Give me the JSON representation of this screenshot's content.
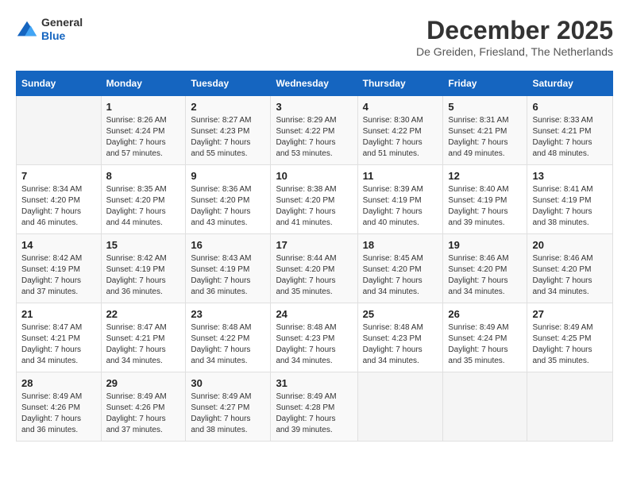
{
  "logo": {
    "general": "General",
    "blue": "Blue"
  },
  "title": "December 2025",
  "location": "De Greiden, Friesland, The Netherlands",
  "headers": [
    "Sunday",
    "Monday",
    "Tuesday",
    "Wednesday",
    "Thursday",
    "Friday",
    "Saturday"
  ],
  "weeks": [
    [
      {
        "day": "",
        "info": ""
      },
      {
        "day": "1",
        "info": "Sunrise: 8:26 AM\nSunset: 4:24 PM\nDaylight: 7 hours\nand 57 minutes."
      },
      {
        "day": "2",
        "info": "Sunrise: 8:27 AM\nSunset: 4:23 PM\nDaylight: 7 hours\nand 55 minutes."
      },
      {
        "day": "3",
        "info": "Sunrise: 8:29 AM\nSunset: 4:22 PM\nDaylight: 7 hours\nand 53 minutes."
      },
      {
        "day": "4",
        "info": "Sunrise: 8:30 AM\nSunset: 4:22 PM\nDaylight: 7 hours\nand 51 minutes."
      },
      {
        "day": "5",
        "info": "Sunrise: 8:31 AM\nSunset: 4:21 PM\nDaylight: 7 hours\nand 49 minutes."
      },
      {
        "day": "6",
        "info": "Sunrise: 8:33 AM\nSunset: 4:21 PM\nDaylight: 7 hours\nand 48 minutes."
      }
    ],
    [
      {
        "day": "7",
        "info": "Sunrise: 8:34 AM\nSunset: 4:20 PM\nDaylight: 7 hours\nand 46 minutes."
      },
      {
        "day": "8",
        "info": "Sunrise: 8:35 AM\nSunset: 4:20 PM\nDaylight: 7 hours\nand 44 minutes."
      },
      {
        "day": "9",
        "info": "Sunrise: 8:36 AM\nSunset: 4:20 PM\nDaylight: 7 hours\nand 43 minutes."
      },
      {
        "day": "10",
        "info": "Sunrise: 8:38 AM\nSunset: 4:20 PM\nDaylight: 7 hours\nand 41 minutes."
      },
      {
        "day": "11",
        "info": "Sunrise: 8:39 AM\nSunset: 4:19 PM\nDaylight: 7 hours\nand 40 minutes."
      },
      {
        "day": "12",
        "info": "Sunrise: 8:40 AM\nSunset: 4:19 PM\nDaylight: 7 hours\nand 39 minutes."
      },
      {
        "day": "13",
        "info": "Sunrise: 8:41 AM\nSunset: 4:19 PM\nDaylight: 7 hours\nand 38 minutes."
      }
    ],
    [
      {
        "day": "14",
        "info": "Sunrise: 8:42 AM\nSunset: 4:19 PM\nDaylight: 7 hours\nand 37 minutes."
      },
      {
        "day": "15",
        "info": "Sunrise: 8:42 AM\nSunset: 4:19 PM\nDaylight: 7 hours\nand 36 minutes."
      },
      {
        "day": "16",
        "info": "Sunrise: 8:43 AM\nSunset: 4:19 PM\nDaylight: 7 hours\nand 36 minutes."
      },
      {
        "day": "17",
        "info": "Sunrise: 8:44 AM\nSunset: 4:20 PM\nDaylight: 7 hours\nand 35 minutes."
      },
      {
        "day": "18",
        "info": "Sunrise: 8:45 AM\nSunset: 4:20 PM\nDaylight: 7 hours\nand 34 minutes."
      },
      {
        "day": "19",
        "info": "Sunrise: 8:46 AM\nSunset: 4:20 PM\nDaylight: 7 hours\nand 34 minutes."
      },
      {
        "day": "20",
        "info": "Sunrise: 8:46 AM\nSunset: 4:20 PM\nDaylight: 7 hours\nand 34 minutes."
      }
    ],
    [
      {
        "day": "21",
        "info": "Sunrise: 8:47 AM\nSunset: 4:21 PM\nDaylight: 7 hours\nand 34 minutes."
      },
      {
        "day": "22",
        "info": "Sunrise: 8:47 AM\nSunset: 4:21 PM\nDaylight: 7 hours\nand 34 minutes."
      },
      {
        "day": "23",
        "info": "Sunrise: 8:48 AM\nSunset: 4:22 PM\nDaylight: 7 hours\nand 34 minutes."
      },
      {
        "day": "24",
        "info": "Sunrise: 8:48 AM\nSunset: 4:23 PM\nDaylight: 7 hours\nand 34 minutes."
      },
      {
        "day": "25",
        "info": "Sunrise: 8:48 AM\nSunset: 4:23 PM\nDaylight: 7 hours\nand 34 minutes."
      },
      {
        "day": "26",
        "info": "Sunrise: 8:49 AM\nSunset: 4:24 PM\nDaylight: 7 hours\nand 35 minutes."
      },
      {
        "day": "27",
        "info": "Sunrise: 8:49 AM\nSunset: 4:25 PM\nDaylight: 7 hours\nand 35 minutes."
      }
    ],
    [
      {
        "day": "28",
        "info": "Sunrise: 8:49 AM\nSunset: 4:26 PM\nDaylight: 7 hours\nand 36 minutes."
      },
      {
        "day": "29",
        "info": "Sunrise: 8:49 AM\nSunset: 4:26 PM\nDaylight: 7 hours\nand 37 minutes."
      },
      {
        "day": "30",
        "info": "Sunrise: 8:49 AM\nSunset: 4:27 PM\nDaylight: 7 hours\nand 38 minutes."
      },
      {
        "day": "31",
        "info": "Sunrise: 8:49 AM\nSunset: 4:28 PM\nDaylight: 7 hours\nand 39 minutes."
      },
      {
        "day": "",
        "info": ""
      },
      {
        "day": "",
        "info": ""
      },
      {
        "day": "",
        "info": ""
      }
    ]
  ]
}
